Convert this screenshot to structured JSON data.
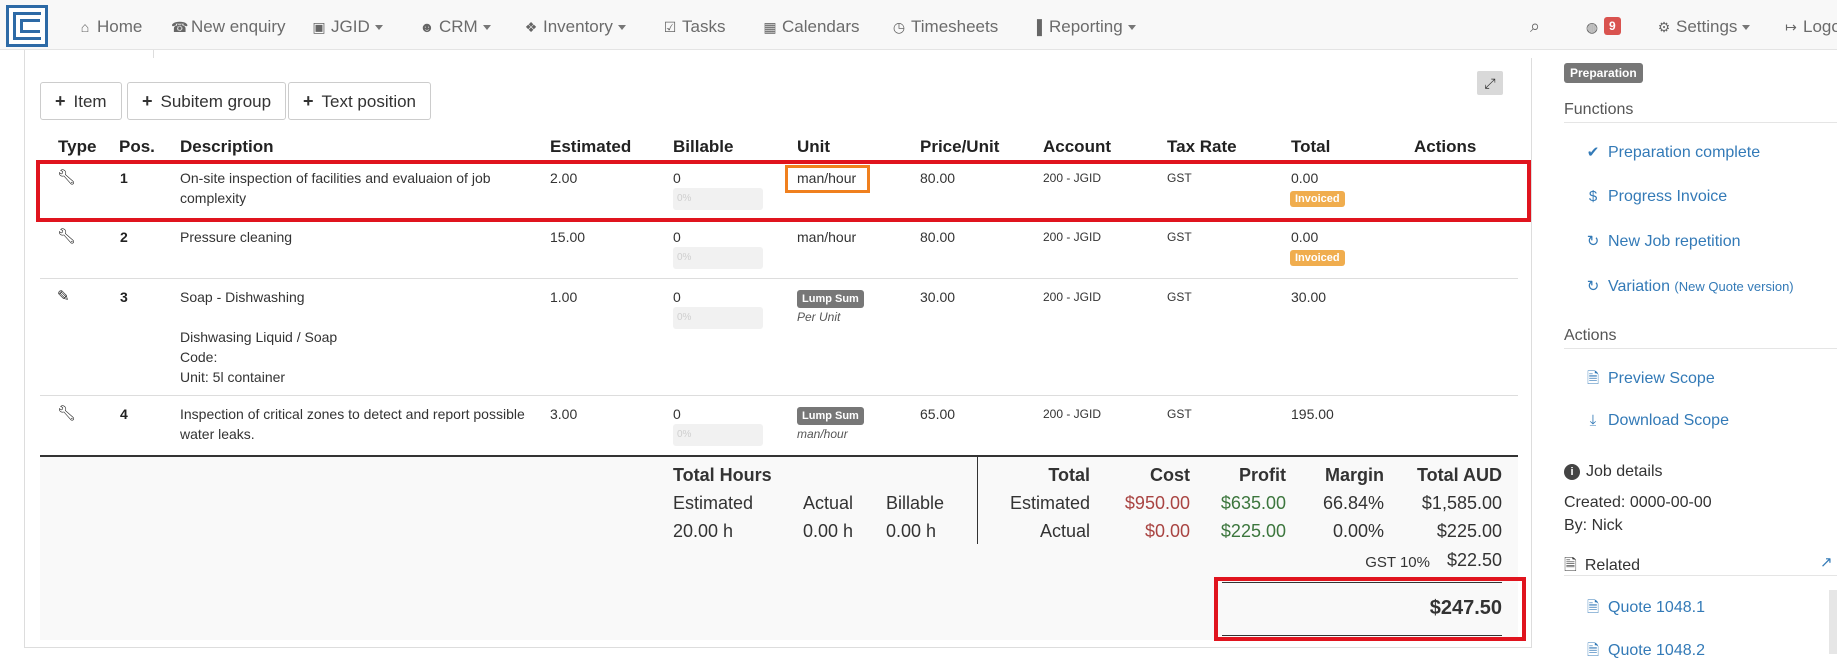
{
  "navbar": {
    "items": [
      {
        "icon": "home-icon",
        "glyph": "⌂",
        "label": "Home",
        "dropdown": false
      },
      {
        "icon": "phone-icon",
        "glyph": "☎",
        "label": "New enquiry",
        "dropdown": false
      },
      {
        "icon": "jgid-icon",
        "glyph": "▣",
        "label": "JGID",
        "dropdown": true
      },
      {
        "icon": "users-icon",
        "glyph": "☻",
        "label": "CRM",
        "dropdown": true
      },
      {
        "icon": "cubes-icon",
        "glyph": "❖",
        "label": "Inventory",
        "dropdown": true
      },
      {
        "icon": "check-square-icon",
        "glyph": "☑",
        "label": "Tasks",
        "dropdown": false
      },
      {
        "icon": "calendar-icon",
        "glyph": "▦",
        "label": "Calendars",
        "dropdown": false
      },
      {
        "icon": "clock-icon",
        "glyph": "◷",
        "label": "Timesheets",
        "dropdown": false
      },
      {
        "icon": "bar-chart-icon",
        "glyph": "▐",
        "label": "Reporting",
        "dropdown": true
      }
    ],
    "notifications_count": "9",
    "settings_label": "Settings",
    "logout_label": "Logout"
  },
  "toolbar": {
    "item_label": "Item",
    "subitem_group_label": "Subitem group",
    "text_position_label": "Text position"
  },
  "table": {
    "headers": [
      "Type",
      "Pos.",
      "Description",
      "Estimated",
      "Billable",
      "Unit",
      "Price/Unit",
      "Account",
      "Tax Rate",
      "Total",
      "Actions"
    ],
    "rows": [
      {
        "pos": "1",
        "description": "On-site inspection of facilities and evaluaion of job complexity",
        "estimated": "2.00",
        "billable": "0",
        "progress": "0%",
        "unit": "man/hour",
        "price": "80.00",
        "account": "200 - JGID",
        "tax": "GST",
        "total": "0.00",
        "status": "Invoiced"
      },
      {
        "pos": "2",
        "description": "Pressure cleaning",
        "estimated": "15.00",
        "billable": "0",
        "progress": "0%",
        "unit": "man/hour",
        "price": "80.00",
        "account": "200 - JGID",
        "tax": "GST",
        "total": "0.00",
        "status": "Invoiced"
      },
      {
        "pos": "3",
        "description": "Soap - Dishwashing",
        "details": [
          "Dishwasing Liquid / Soap",
          "Code:",
          "Unit: 5l container"
        ],
        "estimated": "1.00",
        "billable": "0",
        "progress": "0%",
        "unit_badge": "Lump Sum",
        "unit_sub": "Per Unit",
        "price": "30.00",
        "account": "200 - JGID",
        "tax": "GST",
        "total": "30.00"
      },
      {
        "pos": "4",
        "description": "Inspection of critical zones to detect and report possible water leaks.",
        "estimated": "3.00",
        "billable": "0",
        "progress": "0%",
        "unit_badge": "Lump Sum",
        "unit_sub": "man/hour",
        "price": "65.00",
        "account": "200 - JGID",
        "tax": "GST",
        "total": "195.00"
      }
    ]
  },
  "totals": {
    "hours_title": "Total Hours",
    "hours_headers": [
      "Estimated",
      "Actual",
      "Billable"
    ],
    "hours_values": [
      "20.00 h",
      "0.00 h",
      "0.00 h"
    ],
    "money_headers": [
      "Total",
      "Cost",
      "Profit",
      "Margin",
      "Total AUD"
    ],
    "estimated": {
      "label": "Estimated",
      "cost": "$950.00",
      "profit": "$635.00",
      "margin": "66.84%",
      "total": "$1,585.00"
    },
    "actual": {
      "label": "Actual",
      "cost": "$0.00",
      "profit": "$225.00",
      "margin": "0.00%",
      "total": "$225.00"
    },
    "gst_label": "GST 10%",
    "gst_value": "$22.50",
    "grand_total": "$247.50"
  },
  "sidebar": {
    "status_badge": "Preparation",
    "functions_title": "Functions",
    "functions": [
      {
        "label": "Preparation complete",
        "icon": "check-icon"
      },
      {
        "label": "Progress Invoice",
        "icon": "dollar-icon"
      },
      {
        "label": "New Job repetition",
        "icon": "refresh-icon"
      },
      {
        "label": "Variation",
        "sub": "(New Quote version)",
        "icon": "refresh-icon"
      }
    ],
    "actions_title": "Actions",
    "actions": [
      {
        "label": "Preview Scope",
        "icon": "file-pdf-icon"
      },
      {
        "label": "Download Scope",
        "icon": "download-icon"
      }
    ],
    "job_details_title": "Job details",
    "created": "Created: 0000-00-00",
    "by": "By: Nick",
    "related_title": "Related",
    "related": [
      "Quote 1048.1",
      "Quote 1048.2"
    ]
  },
  "colors": {
    "highlight_red": "#e0141e",
    "highlight_orange": "#f0801e",
    "link_blue": "#337ab7",
    "invoiced_orange": "#f0ad4e"
  }
}
